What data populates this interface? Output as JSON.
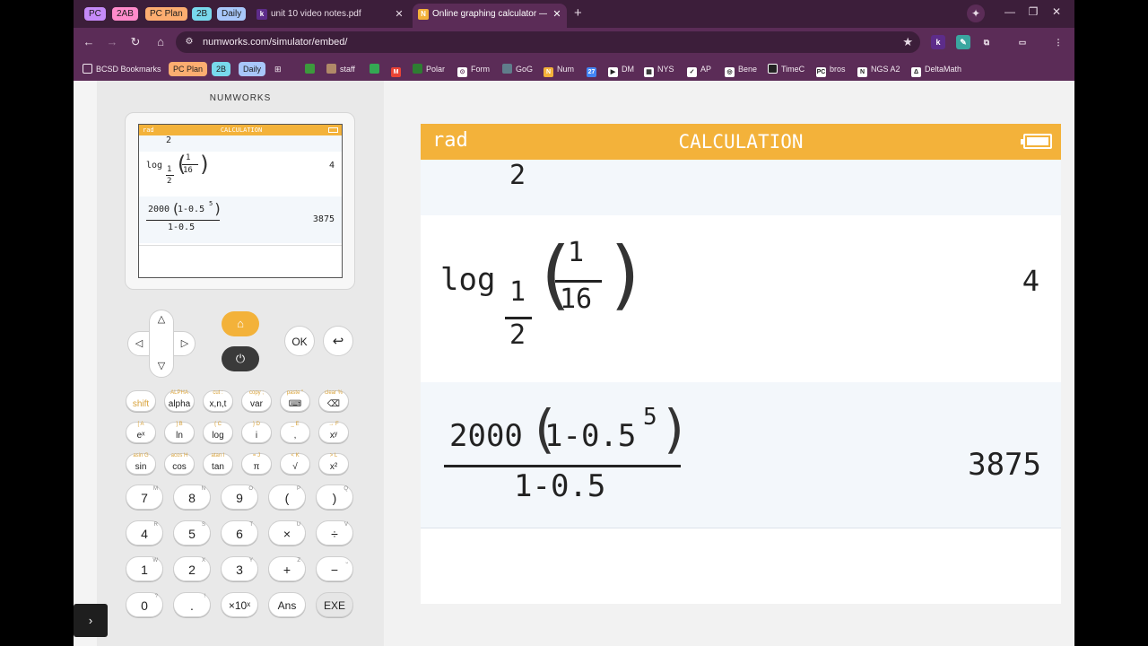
{
  "tab_groups": [
    {
      "label": "PC",
      "color": "#c58af9"
    },
    {
      "label": "2AB",
      "color": "#ff8bcb"
    },
    {
      "label": "PC Plan",
      "color": "#fcad70"
    },
    {
      "label": "2B",
      "color": "#78d9ec"
    },
    {
      "label": "Daily",
      "color": "#a8c7fa"
    }
  ],
  "tabs": [
    {
      "title": "unit 10 video notes.pdf",
      "favicon": "k",
      "active": false
    },
    {
      "title": "Online graphing calculator — Nu",
      "favicon": "N",
      "active": true
    }
  ],
  "new_tab": "+",
  "toolbar": {
    "url": "numworks.com/simulator/embed/"
  },
  "bookmarks": [
    {
      "label": "BCSD Bookmarks",
      "icon": "folder-icon"
    },
    {
      "label": "PC Plan",
      "pill": "#fcad70"
    },
    {
      "label": "2B",
      "pill": "#78d9ec"
    },
    {
      "label": "Daily",
      "pill": "#a8c7fa"
    },
    {
      "label": "",
      "icon": "apps-grid-icon"
    },
    {
      "label": "",
      "icon": "leaf-icon"
    },
    {
      "label": "staff",
      "icon": "sheet-icon"
    },
    {
      "label": "",
      "icon": "drive-icon"
    },
    {
      "label": "",
      "icon": "gmail-icon"
    },
    {
      "label": "Polar",
      "icon": "polar-icon"
    },
    {
      "label": "Form",
      "icon": "form-icon"
    },
    {
      "label": "GoG",
      "icon": "gog-icon"
    },
    {
      "label": "Num",
      "icon": "numworks-icon"
    },
    {
      "label": "",
      "icon": "calendar-icon"
    },
    {
      "label": "DM",
      "icon": "dm-icon"
    },
    {
      "label": "NYS",
      "icon": "nys-icon"
    },
    {
      "label": "AP",
      "icon": "ap-icon"
    },
    {
      "label": "Bene",
      "icon": "globe-icon"
    },
    {
      "label": "TimeC",
      "icon": "clock-icon"
    },
    {
      "label": "bros",
      "icon": "pc-icon"
    },
    {
      "label": "NGS A2",
      "icon": "ngs-icon"
    },
    {
      "label": "DeltaMath",
      "icon": "deltamath-icon"
    }
  ],
  "calculator": {
    "brand": "NUMWORKS",
    "header": {
      "angle_mode": "rad",
      "app": "CALCULATION"
    },
    "history": [
      {
        "expr_partial": "2"
      },
      {
        "expr": {
          "func": "log",
          "base_num": "1",
          "base_den": "2",
          "arg_num": "1",
          "arg_den": "16"
        },
        "result": "4"
      },
      {
        "expr": {
          "coef": "2000",
          "inner": "1-0.5",
          "exponent": "5",
          "den": "1-0.5"
        },
        "result": "3875"
      }
    ],
    "nav": {
      "ok": "OK",
      "back": "↩",
      "up": "△",
      "down": "▽",
      "left": "◁",
      "right": "▷",
      "home": "⌂",
      "power": "⏻"
    },
    "func_keys": [
      [
        {
          "main": "shift",
          "top": ""
        },
        {
          "main": "alpha",
          "top": "ALPHA"
        },
        {
          "main": "x,n,t",
          "top": "cut :"
        },
        {
          "main": "var",
          "top": "copy ;"
        },
        {
          "main": "⌨",
          "top": "paste \""
        },
        {
          "main": "⌫",
          "top": "clear %"
        }
      ],
      [
        {
          "main": "eˣ",
          "top": "[  A"
        },
        {
          "main": "ln",
          "top": "]  B"
        },
        {
          "main": "log",
          "top": "{  C"
        },
        {
          "main": "i",
          "top": "}  D"
        },
        {
          "main": ",",
          "top": "_  E"
        },
        {
          "main": "xʸ",
          "top": "→  F"
        }
      ],
      [
        {
          "main": "sin",
          "top": "asin G"
        },
        {
          "main": "cos",
          "top": "acos H"
        },
        {
          "main": "tan",
          "top": "atan I"
        },
        {
          "main": "π",
          "top": "=  J"
        },
        {
          "main": "√",
          "top": "<  K"
        },
        {
          "main": "x²",
          "top": ">  L"
        }
      ]
    ],
    "num_keys": [
      [
        {
          "main": "7",
          "sup": "M"
        },
        {
          "main": "8",
          "sup": "N"
        },
        {
          "main": "9",
          "sup": "O"
        },
        {
          "main": "(",
          "sup": "P"
        },
        {
          "main": ")",
          "sup": "Q"
        }
      ],
      [
        {
          "main": "4",
          "sup": "R"
        },
        {
          "main": "5",
          "sup": "S"
        },
        {
          "main": "6",
          "sup": "T"
        },
        {
          "main": "×",
          "sup": "U"
        },
        {
          "main": "÷",
          "sup": "V"
        }
      ],
      [
        {
          "main": "1",
          "sup": "W"
        },
        {
          "main": "2",
          "sup": "X"
        },
        {
          "main": "3",
          "sup": "Y"
        },
        {
          "main": "+",
          "sup": "Z"
        },
        {
          "main": "−",
          "sup": "⎵"
        }
      ],
      [
        {
          "main": "0",
          "sup": "?"
        },
        {
          "main": ".",
          "sup": "!"
        },
        {
          "main": "×10ˣ",
          "sup": ""
        },
        {
          "main": "Ans",
          "sup": ""
        },
        {
          "main": "EXE",
          "sup": ""
        }
      ]
    ]
  },
  "side_toggle": "›"
}
